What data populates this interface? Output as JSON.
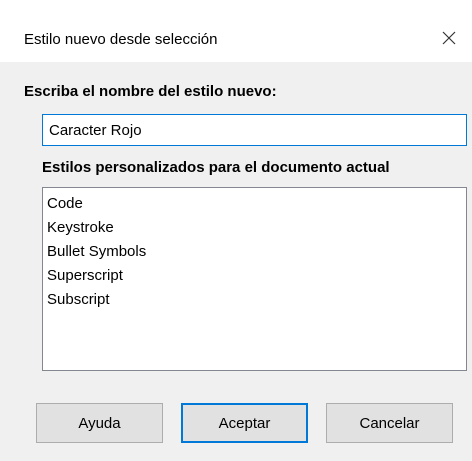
{
  "dialog": {
    "title": "Estilo nuevo desde selección",
    "close_icon": "close-icon"
  },
  "form": {
    "name_label": "Escriba el nombre del estilo nuevo:",
    "name_value": "Caracter Rojo",
    "list_label": "Estilos personalizados para el documento actual",
    "styles": [
      "Code",
      "Keystroke",
      "Bullet Symbols",
      "Superscript",
      "Subscript"
    ]
  },
  "buttons": {
    "help": "Ayuda",
    "ok": "Aceptar",
    "cancel": "Cancelar"
  },
  "colors": {
    "focus_accent": "#0078d7",
    "dialog_background": "#f0f0f0",
    "button_face": "#e1e1e1"
  }
}
